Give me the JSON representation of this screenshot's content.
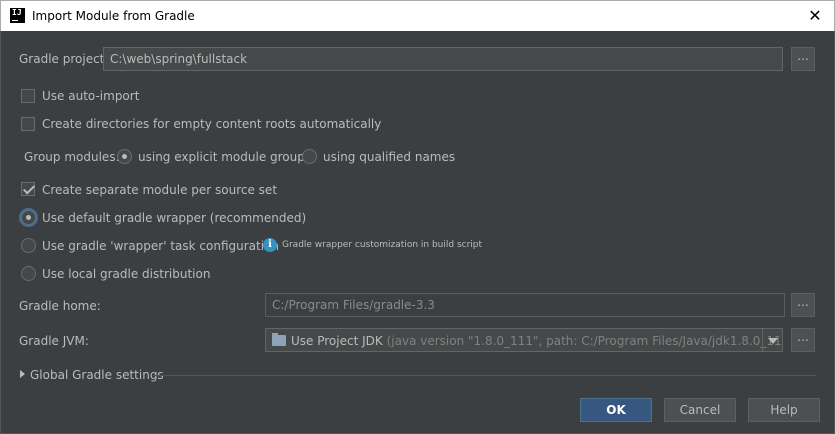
{
  "window": {
    "title": "Import Module from Gradle",
    "app_icon_text": "IJ"
  },
  "gradle_project": {
    "label": "Gradle project:",
    "value": "C:\\web\\spring\\fullstack",
    "browse_label": "..."
  },
  "options": {
    "auto_import": {
      "label": "Use auto-import",
      "checked": false
    },
    "create_dirs": {
      "label": "Create directories for empty content roots automatically",
      "checked": false
    },
    "separate_module": {
      "label": "Create separate module per source set",
      "checked": true
    }
  },
  "group_modules": {
    "label": "Group modules:",
    "explicit": "using explicit module groups",
    "qualified": "using qualified names",
    "selected": "explicit"
  },
  "distribution": {
    "default_wrapper": "Use default gradle wrapper (recommended)",
    "wrapper_task": "Use gradle 'wrapper' task configuration",
    "wrapper_hint": "Gradle wrapper customization in build script",
    "local": "Use local gradle distribution",
    "selected": "default_wrapper"
  },
  "gradle_home": {
    "label": "Gradle home:",
    "value": "C:/Program Files/gradle-3.3",
    "browse_label": "..."
  },
  "gradle_jvm": {
    "label": "Gradle JVM:",
    "value": "Use Project JDK",
    "detail": "(java version \"1.8.0_111\", path: C:/Program Files/Java/jdk1.8.0_111)",
    "browse_label": "..."
  },
  "global_settings": {
    "label": "Global Gradle settings"
  },
  "buttons": {
    "ok": "OK",
    "cancel": "Cancel",
    "help": "Help"
  },
  "colors": {
    "background": "#3c3f41",
    "primary_button": "#365880",
    "info": "#3592c4"
  }
}
